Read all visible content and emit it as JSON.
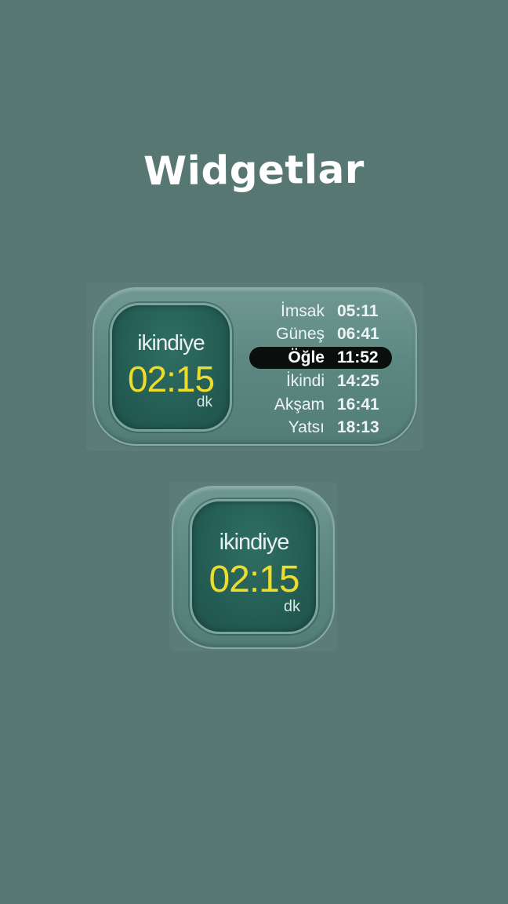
{
  "heading": "Widgetlar",
  "wide_widget": {
    "countdown": {
      "label": "ikindiye",
      "time": "02:15",
      "unit": "dk"
    },
    "prayer_times": [
      {
        "name": "İmsak",
        "time": "05:11",
        "active": false
      },
      {
        "name": "Güneş",
        "time": "06:41",
        "active": false
      },
      {
        "name": "Öğle",
        "time": "11:52",
        "active": true
      },
      {
        "name": "İkindi",
        "time": "14:25",
        "active": false
      },
      {
        "name": "Akşam",
        "time": "16:41",
        "active": false
      },
      {
        "name": "Yatsı",
        "time": "18:13",
        "active": false
      }
    ]
  },
  "square_widget": {
    "countdown": {
      "label": "ikindiye",
      "time": "02:15",
      "unit": "dk"
    }
  },
  "colors": {
    "background": "#577872",
    "countdown_time": "#ecdc2c",
    "active_row": "#0a0f0e"
  }
}
